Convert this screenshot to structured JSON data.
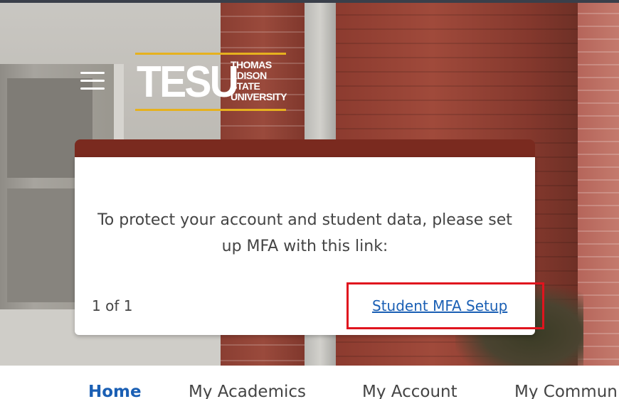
{
  "header": {
    "logo": {
      "mark": "TESU",
      "name_lines": [
        "THOMAS",
        "EDISON",
        "STATE",
        "UNIVERSITY"
      ],
      "rule_color": "#e6b11e"
    },
    "menu_icon": "hamburger-menu-icon"
  },
  "card": {
    "accent_color": "#7a2a1f",
    "message": "To protect your account and student data, please set up MFA with this link:",
    "pager": "1 of 1",
    "link_label": "Student MFA Setup",
    "highlight_color": "#e0141e"
  },
  "nav": {
    "tabs": [
      {
        "label": "Home",
        "active": true
      },
      {
        "label": "My Academics",
        "active": false
      },
      {
        "label": "My Account",
        "active": false
      },
      {
        "label": "My Commun",
        "active": false
      }
    ]
  }
}
